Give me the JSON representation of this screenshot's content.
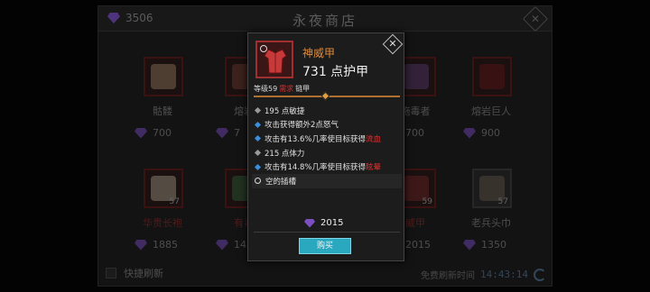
{
  "shop": {
    "title": "永夜商店",
    "currency": "3506",
    "refresh_label": "快捷刷新",
    "free_refresh_label": "免费刷新时间",
    "timer": "14:43:14"
  },
  "slots_row1": [
    {
      "name": "骷髅",
      "price": "700",
      "lvl": ""
    },
    {
      "name": "熔岩",
      "price": "7",
      "lvl": ""
    },
    {
      "name": "施毒者",
      "price": "700",
      "lvl": ""
    },
    {
      "name": "熔岩巨人",
      "price": "900",
      "lvl": ""
    }
  ],
  "slots_row2": [
    {
      "name": "华贵长袍",
      "price": "1885",
      "lvl": "57"
    },
    {
      "name": "有毒",
      "price": "14",
      "lvl": ""
    },
    {
      "name": "威甲",
      "price": "2015",
      "lvl": "59"
    },
    {
      "name": "老兵头巾",
      "price": "1350",
      "lvl": "57"
    }
  ],
  "tooltip": {
    "name": "神威甲",
    "armor": "731 点护甲",
    "level_label": "等级59",
    "requirement": "需求",
    "type": "链甲",
    "stats": [
      {
        "text": "195 点敏捷",
        "hi": "",
        "dot": "grey"
      },
      {
        "text": "攻击获得额外2点怒气",
        "hi": "",
        "dot": "blue"
      },
      {
        "text": "攻击有13.6%几率使目标获得",
        "hi": "流血",
        "dot": "blue"
      },
      {
        "text": "215 点体力",
        "hi": "",
        "dot": "grey"
      },
      {
        "text": "攻击有14.8%几率使目标获得",
        "hi": "眩晕",
        "dot": "blue"
      },
      {
        "text": "空的插槽",
        "hi": "",
        "dot": "ring"
      }
    ],
    "price": "2015",
    "buy_label": "购买"
  },
  "colors": {
    "accent": "#e08a3a",
    "gem": "#7b4fc0",
    "buy": "#2aa8c0",
    "warn": "#e03030"
  }
}
